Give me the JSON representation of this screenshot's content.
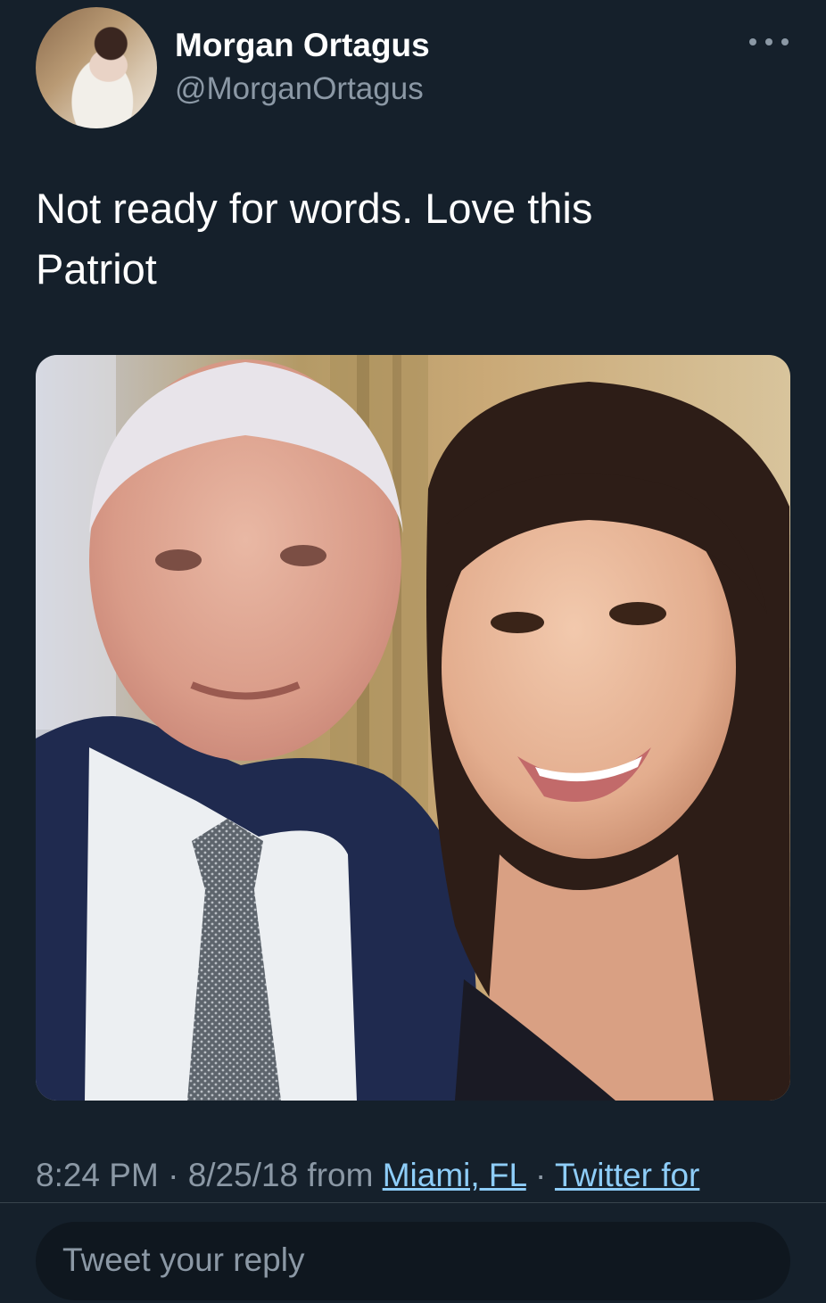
{
  "tweet": {
    "author": {
      "display_name": "Morgan Ortagus",
      "handle": "@MorganOrtagus"
    },
    "text_line1": "Not ready for words. Love this",
    "text_line2": "Patriot",
    "meta": {
      "time": "8:24 PM",
      "sep1": " · ",
      "date": "8/25/18",
      "from_word": " from ",
      "location": "Miami, FL",
      "sep2": " · ",
      "source": "Twitter for"
    }
  },
  "reply": {
    "placeholder": "Tweet your reply"
  },
  "colors": {
    "background": "#15202b",
    "text_primary": "#ffffff",
    "text_secondary": "#8b98a5",
    "link": "#8ecdf8",
    "divider": "#38444d",
    "reply_box": "#0f171f"
  },
  "icons": {
    "more": "more-horizontal-icon"
  }
}
